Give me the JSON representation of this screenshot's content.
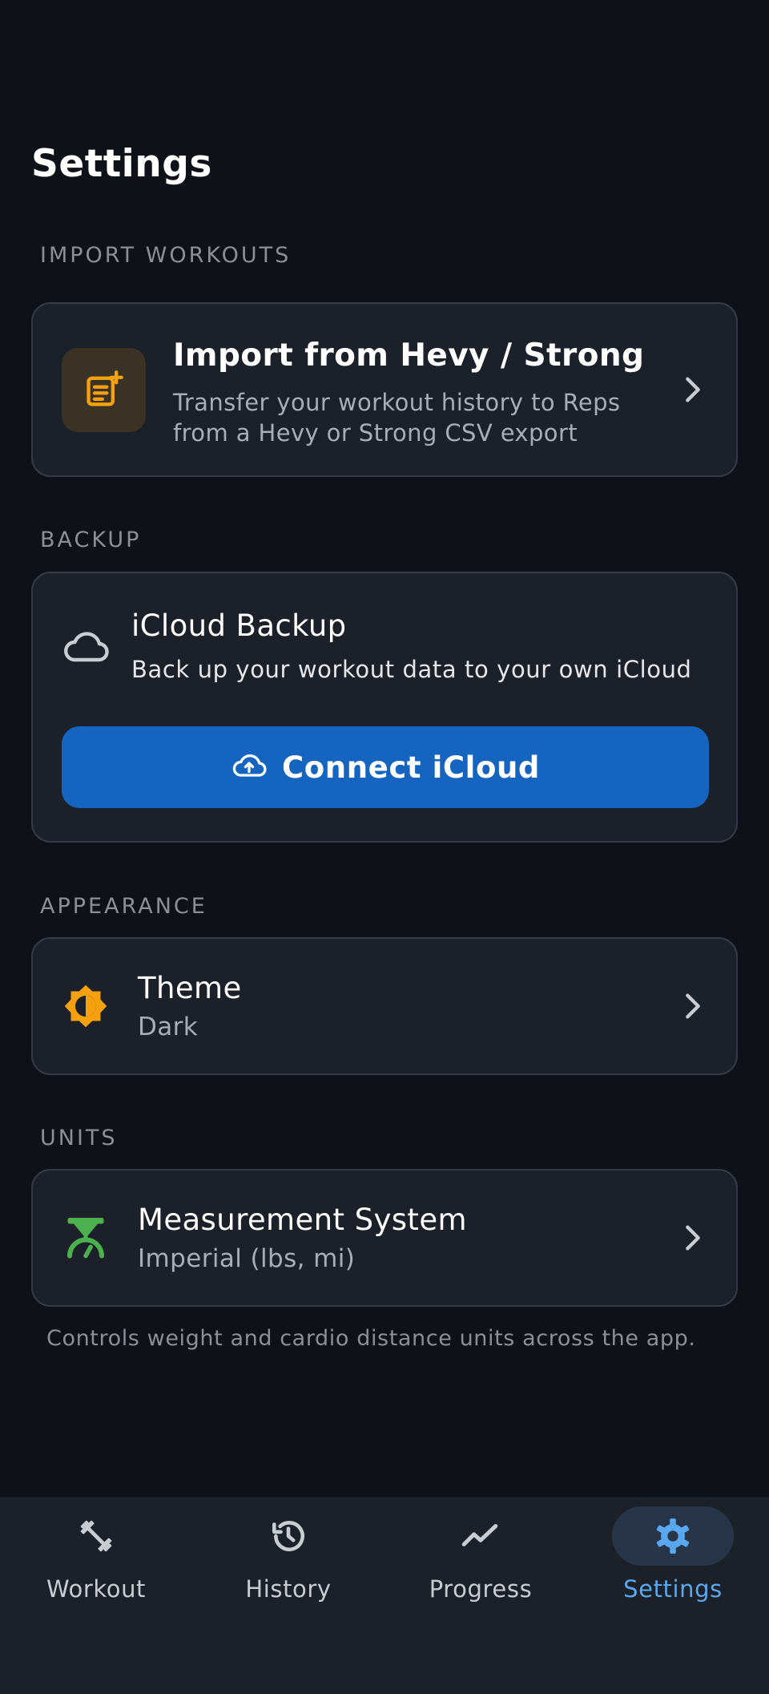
{
  "header": {
    "title": "Settings"
  },
  "sections": {
    "import": {
      "label": "IMPORT WORKOUTS",
      "title": "Import from Hevy / Strong",
      "description": "Transfer your workout history to Reps from a Hevy or Strong CSV export",
      "icon": "import-document-icon"
    },
    "backup": {
      "label": "BACKUP",
      "title": "iCloud Backup",
      "description": "Back up your workout data to your own iCloud",
      "button_label": "Connect iCloud",
      "icon": "cloud-icon",
      "button_icon": "cloud-upload-icon"
    },
    "appearance": {
      "label": "APPEARANCE",
      "title": "Theme",
      "value": "Dark",
      "icon": "brightness-icon"
    },
    "units": {
      "label": "UNITS",
      "title": "Measurement System",
      "value": "Imperial (lbs, mi)",
      "footnote": "Controls weight and cardio distance units across the app.",
      "icon": "scale-icon"
    }
  },
  "nav": {
    "items": [
      {
        "label": "Workout",
        "icon": "dumbbell-icon",
        "active": false
      },
      {
        "label": "History",
        "icon": "history-icon",
        "active": false
      },
      {
        "label": "Progress",
        "icon": "trend-icon",
        "active": false
      },
      {
        "label": "Settings",
        "icon": "gear-icon",
        "active": true
      }
    ]
  },
  "colors": {
    "background": "#0e1117",
    "card": "#1c2029",
    "accent_blue": "#1565c0",
    "active_nav": "#5aa7ee",
    "orange": "#f5a00f",
    "green": "#4caf50"
  }
}
